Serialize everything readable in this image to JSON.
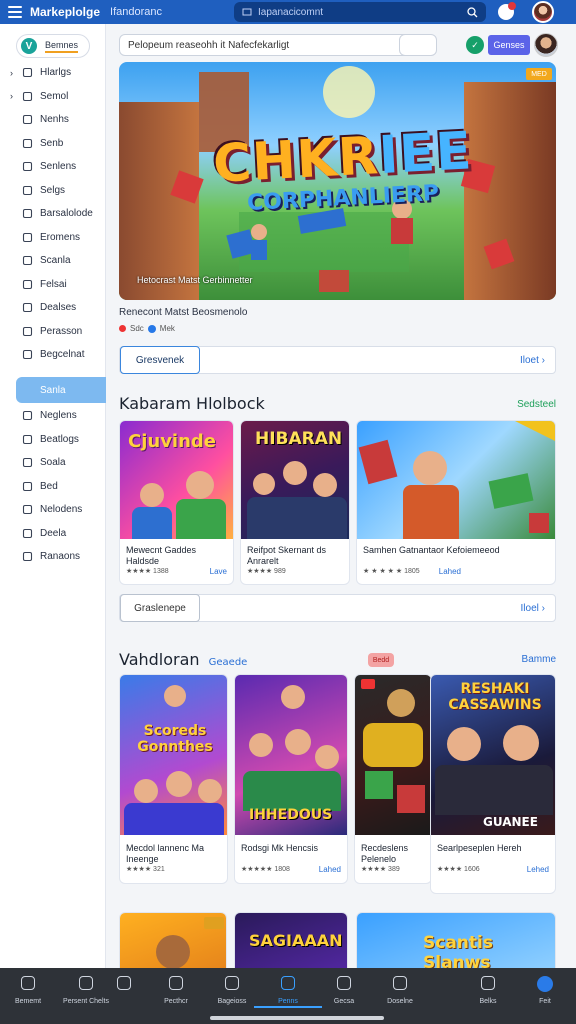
{
  "topbar": {
    "brand": "Markeplolge",
    "title": "Ifandoranc",
    "search_placeholder": "Iapanacicomnt"
  },
  "sidebar": {
    "logo_label": "Bemnes",
    "items": [
      {
        "label": "Hlarlgs",
        "icon": "chevron-icon"
      },
      {
        "label": "Semol",
        "icon": "trophy-icon"
      },
      {
        "label": "Nenhs",
        "icon": "bag-icon"
      },
      {
        "label": "Senb",
        "icon": "document-icon"
      },
      {
        "label": "Senlens",
        "icon": "page-icon"
      },
      {
        "label": "Selgs",
        "icon": "clock-icon"
      },
      {
        "label": "Barsalolode",
        "icon": "calendar-icon"
      },
      {
        "label": "Eromens",
        "icon": "list-icon"
      },
      {
        "label": "Scanla",
        "icon": "tag-icon"
      },
      {
        "label": "Felsai",
        "icon": "receipt-icon"
      },
      {
        "label": "Dealses",
        "icon": "note-icon"
      },
      {
        "label": "Perasson",
        "icon": "key-icon"
      },
      {
        "label": "Begcelnat",
        "icon": "shield-icon"
      }
    ],
    "active_label": "Sanla",
    "items2": [
      {
        "label": "Neglens",
        "icon": "folder-icon"
      },
      {
        "label": "Beatlogs",
        "icon": "book-icon"
      },
      {
        "label": "Soala",
        "icon": "grid-icon"
      },
      {
        "label": "Bed",
        "icon": "bed-icon"
      },
      {
        "label": "Nelodens",
        "icon": "layers-icon"
      },
      {
        "label": "Deela",
        "icon": "box-icon"
      },
      {
        "label": "Ranaons",
        "icon": "tool-icon"
      }
    ]
  },
  "main": {
    "search_placeholder": "Pelopeum reaseohh it Nafecfekarligt",
    "header_button": "Genses",
    "hero": {
      "title_1": "CHKR",
      "title_2": "IEE",
      "subtitle": "CORPHANLIERP",
      "badge": "MED",
      "caption": "Hetocrast Matst Gerbinnetter",
      "info": "Renecont Matst Beosmenolo",
      "meta": "Sdc",
      "meta2": "Mek"
    },
    "row1": {
      "button": "Gresvenek",
      "more": "Iloet"
    },
    "section1": {
      "title": "Kabaram Hlolbock",
      "link": "Sedsteel",
      "link_color": "#1ea05a"
    },
    "cards1": [
      {
        "art_title": "Cjuvinde",
        "title": "Mewecnt Gaddes Haldsde",
        "meta": "★★★★ 1388",
        "link": "Lave"
      },
      {
        "art_title": "HIBARAN",
        "title": "Reifpot Skernant ds Anrarelt",
        "meta": "★★★★ 989",
        "link": ""
      },
      {
        "art_title": "",
        "title": "Samhen Gatnantaor Kefoiemeeod",
        "meta": "★ ★ ★ ★ ★ 1805",
        "link": "Lahed"
      }
    ],
    "row2": {
      "button": "Graslenepe",
      "more": "Iloel"
    },
    "section2": {
      "title": "Vahdloran",
      "subtitle": "Geaede",
      "chip": "Bedd",
      "link": "Bamme"
    },
    "cards2": [
      {
        "art_title": "Scoreds Gonnthes",
        "title": "Mecdol lannenc Ma Ineenge",
        "meta": "★★★★ 321"
      },
      {
        "art_title": "IHHEDOUS",
        "title": "Rodsgi Mk Hencsis",
        "meta": "★★★★★ 1808",
        "link": "Lahed"
      },
      {
        "art_title": "",
        "title": "Recdeslens Pelenelo",
        "meta": "★★★★ 389"
      },
      {
        "art_title": "RESHAKI CASSAWINS",
        "art_sub": "GUANEE",
        "title": "Searlpeseplen Hereh",
        "meta": "★★★★ 1606",
        "link": "Lehed"
      }
    ],
    "cards3": [
      {
        "art_title": ""
      },
      {
        "art_title": "SAGIAAAN"
      },
      {
        "art_title": "Scantis Slanws"
      }
    ]
  },
  "bottombar": {
    "tabs": [
      {
        "label": "Bememt",
        "icon": "bolt-icon"
      },
      {
        "label": "Persent Chelts",
        "icon": "user-icon"
      },
      {
        "label": "",
        "icon": "bag-icon"
      },
      {
        "label": "Pecthcr",
        "icon": "folder-icon"
      },
      {
        "label": "Bageioss",
        "icon": "search-icon"
      },
      {
        "label": "Penns",
        "icon": "home-icon"
      },
      {
        "label": "Gecsa",
        "icon": "image-icon"
      },
      {
        "label": "Doselne",
        "icon": "chat-icon"
      },
      {
        "label": "Belks",
        "icon": "gift-icon"
      },
      {
        "label": "Feit",
        "icon": "circle-icon"
      }
    ]
  }
}
